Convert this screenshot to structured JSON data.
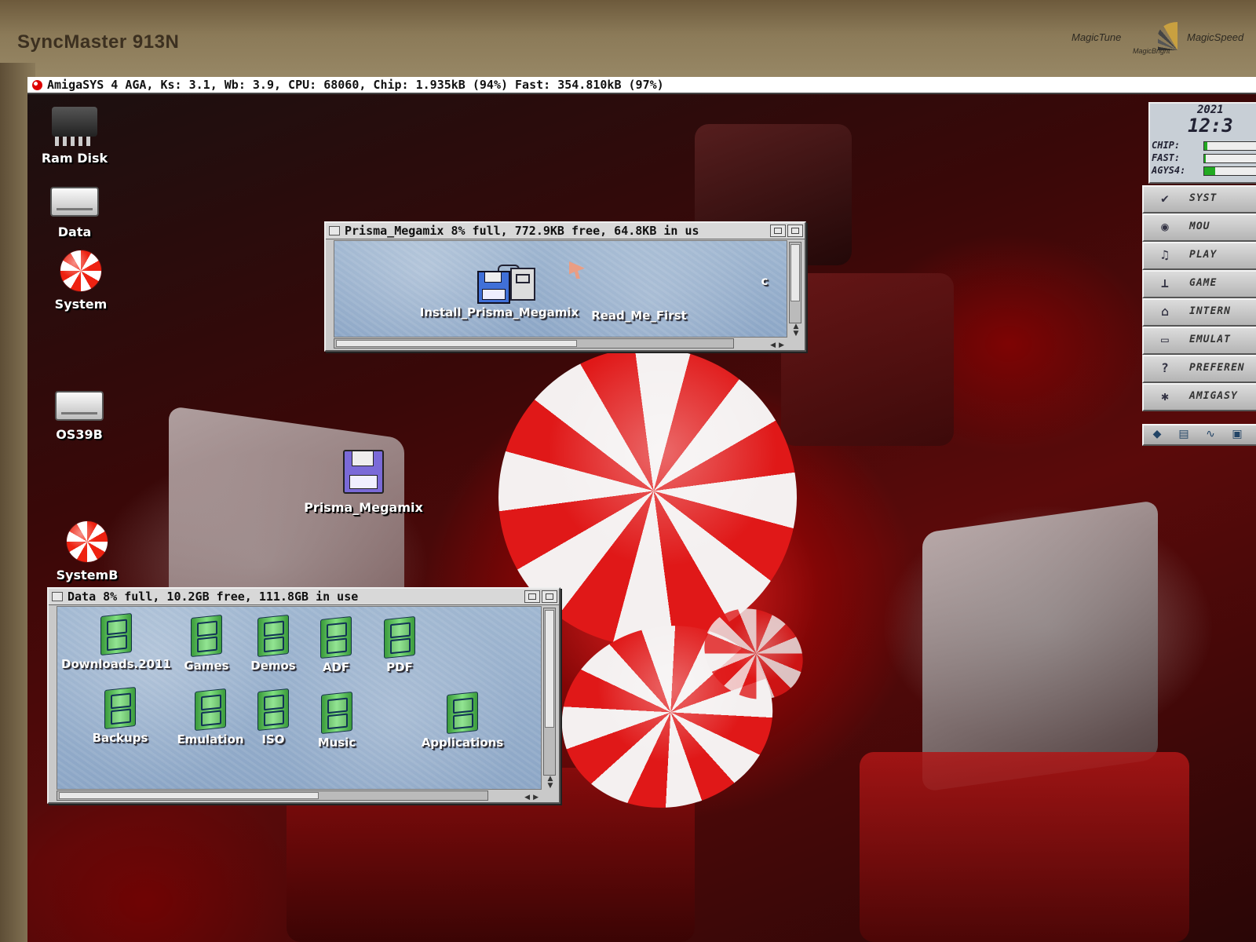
{
  "monitor": {
    "model": "SyncMaster 913N",
    "brand_left": "MagicTune",
    "brand_right": "MagicSpeed",
    "brand_mid": "MagicBright"
  },
  "screen_title": "AmigaSYS 4 AGA, Ks: 3.1, Wb: 3.9, CPU: 68060, Chip: 1.935kB (94%) Fast: 354.810kB (97%)",
  "desktop_icons": [
    {
      "label": "Ram Disk",
      "icon": "ram-chip-icon"
    },
    {
      "label": "Data",
      "icon": "hard-drive-icon"
    },
    {
      "label": "System",
      "icon": "boing-ball-icon"
    },
    {
      "label": "OS39B",
      "icon": "hard-drive-icon"
    },
    {
      "label": "Prisma_Megamix",
      "icon": "floppy-disk-icon"
    },
    {
      "label": "SystemB",
      "icon": "boing-ball-icon"
    }
  ],
  "prisma_window": {
    "title": "Prisma_Megamix  8% full, 772.9KB free, 64.8KB in us",
    "items": [
      {
        "label": "Install_Prisma_Megamix",
        "icon": "installer-icon"
      },
      {
        "label": "Read_Me_First",
        "icon": "document-icon"
      }
    ],
    "stray_glyph": "c"
  },
  "data_window": {
    "title": "Data  8% full, 10.2GB free, 111.8GB in use",
    "items": [
      {
        "label": "Downloads.2011"
      },
      {
        "label": "Games"
      },
      {
        "label": "Demos"
      },
      {
        "label": "ADF"
      },
      {
        "label": "PDF"
      },
      {
        "label": "Backups"
      },
      {
        "label": "Emulation"
      },
      {
        "label": "ISO"
      },
      {
        "label": "Music"
      },
      {
        "label": "Applications"
      }
    ]
  },
  "dock": {
    "clock": {
      "year": "2021",
      "time": "12:3"
    },
    "meters": [
      {
        "label": "CHIP:",
        "fraction": 0.05
      },
      {
        "label": "FAST:",
        "fraction": 0.03
      },
      {
        "label": "AGYS4:",
        "fraction": 0.2
      }
    ],
    "buttons": [
      {
        "label": "SYST",
        "icon": "checkmark-icon",
        "glyph": "✔"
      },
      {
        "label": "MOU",
        "icon": "mouse-icon",
        "glyph": "◉"
      },
      {
        "label": "PLAY",
        "icon": "music-note-icon",
        "glyph": "♫"
      },
      {
        "label": "GAME",
        "icon": "joystick-icon",
        "glyph": "⊥"
      },
      {
        "label": "INTERN",
        "icon": "network-icon",
        "glyph": "⌂"
      },
      {
        "label": "EMULAT",
        "icon": "monitor-icon",
        "glyph": "▭"
      },
      {
        "label": "PREFEREN",
        "icon": "help-icon",
        "glyph": "?"
      },
      {
        "label": "AMIGASY",
        "icon": "amiga-logo-icon",
        "glyph": "✱"
      }
    ],
    "tools": [
      {
        "icon": "drawer-tool-icon",
        "glyph": "◆"
      },
      {
        "icon": "notepad-tool-icon",
        "glyph": "▤"
      },
      {
        "icon": "audio-tool-icon",
        "glyph": "∿"
      },
      {
        "icon": "screen-tool-icon",
        "glyph": "▣"
      }
    ]
  }
}
